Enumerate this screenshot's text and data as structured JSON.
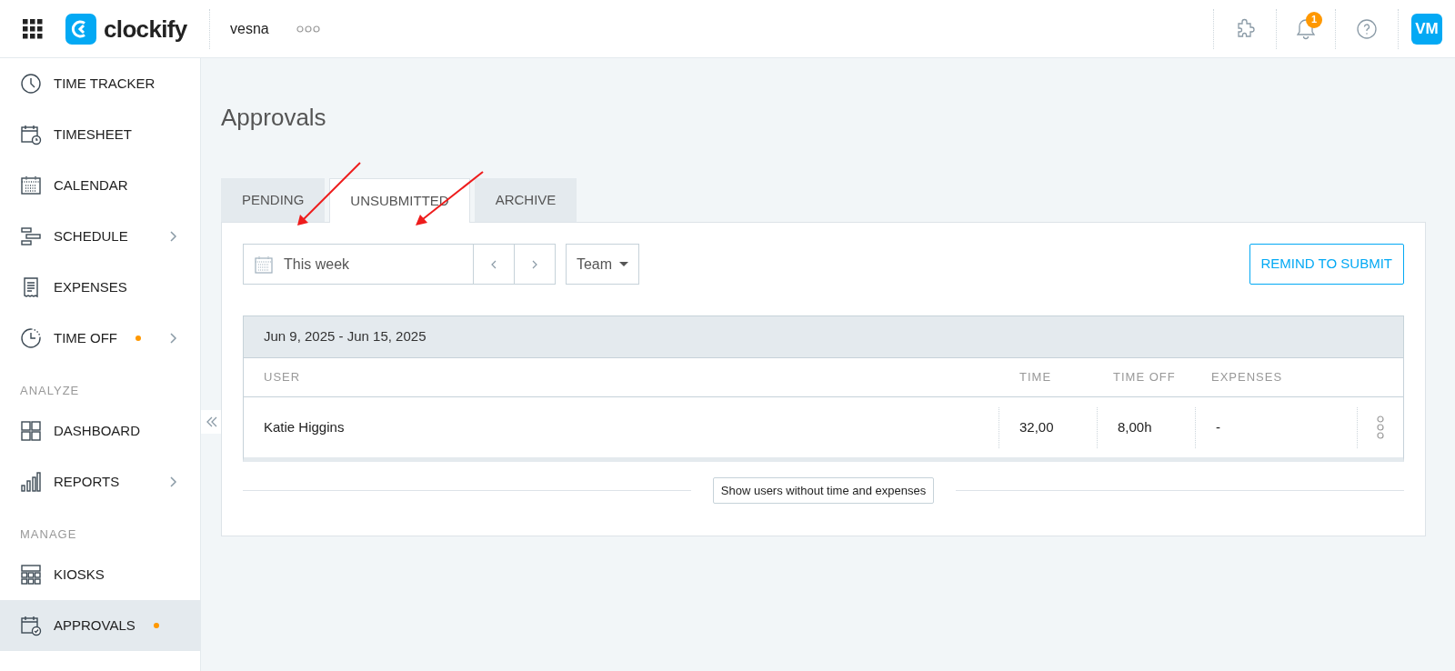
{
  "header": {
    "logo": "clockify",
    "workspace": "vesna",
    "notifications_count": "1",
    "avatar": "VM"
  },
  "sidebar": {
    "items": [
      {
        "kind": "item",
        "label": "TIME TRACKER",
        "dot": false,
        "chevron": false,
        "selected": false
      },
      {
        "kind": "item",
        "label": "TIMESHEET",
        "dot": false,
        "chevron": false,
        "selected": false
      },
      {
        "kind": "item",
        "label": "CALENDAR",
        "dot": false,
        "chevron": false,
        "selected": false
      },
      {
        "kind": "item",
        "label": "SCHEDULE",
        "dot": false,
        "chevron": true,
        "selected": false
      },
      {
        "kind": "item",
        "label": "EXPENSES",
        "dot": false,
        "chevron": false,
        "selected": false
      },
      {
        "kind": "item",
        "label": "TIME OFF",
        "dot": true,
        "chevron": true,
        "selected": false
      },
      {
        "kind": "section",
        "label": "ANALYZE"
      },
      {
        "kind": "item",
        "label": "DASHBOARD",
        "dot": false,
        "chevron": false,
        "selected": false
      },
      {
        "kind": "item",
        "label": "REPORTS",
        "dot": false,
        "chevron": true,
        "selected": false
      },
      {
        "kind": "section",
        "label": "MANAGE"
      },
      {
        "kind": "item",
        "label": "KIOSKS",
        "dot": false,
        "chevron": false,
        "selected": false
      },
      {
        "kind": "item",
        "label": "APPROVALS",
        "dot": true,
        "chevron": false,
        "selected": true
      }
    ]
  },
  "page": {
    "title": "Approvals",
    "tabs": [
      {
        "label": "PENDING",
        "selected": false
      },
      {
        "label": "UNSUBMITTED",
        "selected": true
      },
      {
        "label": "ARCHIVE",
        "selected": false
      }
    ],
    "date_range": "This week",
    "filter": "Team",
    "remind_button": "REMIND TO SUBMIT",
    "table": {
      "period": "Jun 9, 2025 - Jun 15, 2025",
      "columns": [
        "USER",
        "TIME",
        "TIME OFF",
        "EXPENSES"
      ],
      "rows": [
        {
          "user": "Katie Higgins",
          "time": "32,00",
          "time_off": "8,00h",
          "expenses": "-"
        }
      ]
    },
    "show_users_button": "Show users without time and expenses"
  }
}
